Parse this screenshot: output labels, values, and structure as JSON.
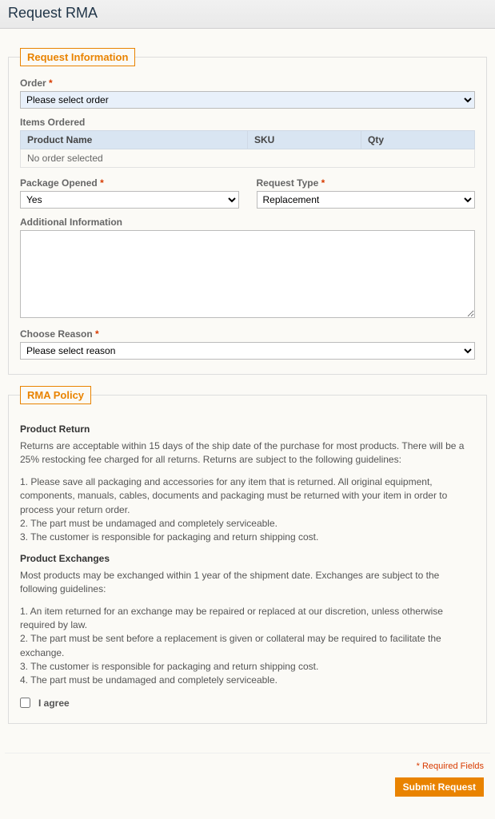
{
  "page_title": "Request RMA",
  "sections": {
    "request_info": {
      "legend": "Request Information",
      "order": {
        "label": "Order",
        "value": "Please select order"
      },
      "items": {
        "label": "Items Ordered",
        "columns": [
          "Product Name",
          "SKU",
          "Qty"
        ],
        "empty": "No order selected"
      },
      "package_opened": {
        "label": "Package Opened",
        "value": "Yes"
      },
      "request_type": {
        "label": "Request Type",
        "value": "Replacement"
      },
      "additional_info": {
        "label": "Additional Information",
        "value": ""
      },
      "reason": {
        "label": "Choose Reason",
        "value": "Please select reason"
      }
    },
    "policy": {
      "legend": "RMA Policy",
      "return_heading": "Product Return",
      "return_intro": "Returns are acceptable within 15 days of the ship date of the purchase for most products. There will be a 25% restocking fee charged for all returns. Returns are subject to the following guidelines:",
      "return_1": "1. Please save all packaging and accessories for any item that is returned. All original equipment, components, manuals, cables, documents and packaging must be returned with your item in order to process your return order.",
      "return_2": "2. The part must be undamaged and completely serviceable.",
      "return_3": "3. The customer is responsible for packaging and return shipping cost.",
      "exchange_heading": "Product Exchanges",
      "exchange_intro": "Most products may be exchanged within 1 year of the shipment date. Exchanges are subject to the following guidelines:",
      "exchange_1": "1. An item returned for an exchange may be repaired or replaced at our discretion, unless otherwise required by law.",
      "exchange_2": "2. The part must be sent before a replacement is given or collateral may be required to facilitate the exchange.",
      "exchange_3": "3. The customer is responsible for packaging and return shipping cost.",
      "exchange_4": "4. The part must be undamaged and completely serviceable.",
      "agree_label": "I agree"
    }
  },
  "footer": {
    "required_note": "* Required Fields",
    "submit_label": "Submit Request"
  }
}
